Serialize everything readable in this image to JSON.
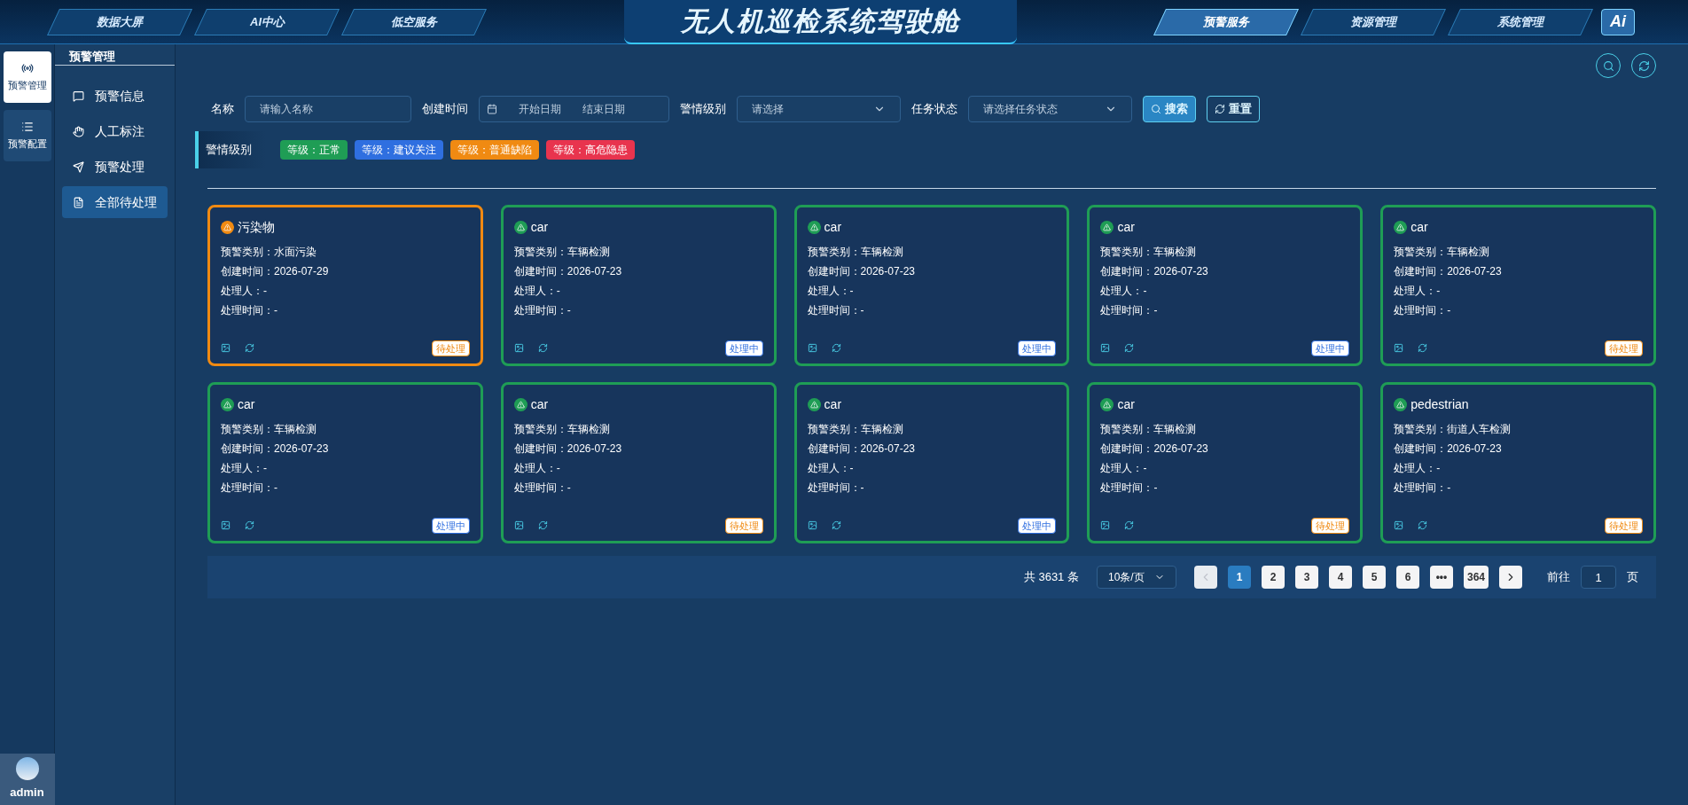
{
  "header": {
    "title": "无人机巡检系统驾驶舱",
    "left_tabs": [
      {
        "label": "数据大屏",
        "selected": false
      },
      {
        "label": "AI中心",
        "selected": false
      },
      {
        "label": "低空服务",
        "selected": false
      }
    ],
    "right_tabs": [
      {
        "label": "预警服务",
        "selected": true
      },
      {
        "label": "资源管理",
        "selected": false
      },
      {
        "label": "系统管理",
        "selected": false
      }
    ],
    "logo": "Ai"
  },
  "rail": {
    "items": [
      {
        "label": "预警管理",
        "selected": true,
        "kind": "signal"
      },
      {
        "label": "预警配置",
        "selected": false,
        "kind": "list"
      }
    ],
    "user": "admin"
  },
  "submenu": {
    "title": "预警管理",
    "items": [
      {
        "label": "预警信息",
        "selected": false,
        "kind": "message"
      },
      {
        "label": "人工标注",
        "selected": false,
        "kind": "hand"
      },
      {
        "label": "预警处理",
        "selected": false,
        "kind": "send"
      },
      {
        "label": "全部待处理",
        "selected": true,
        "kind": "doc"
      }
    ]
  },
  "filters": {
    "name": {
      "label": "名称",
      "placeholder": "请输入名称"
    },
    "date": {
      "label": "创建时间",
      "start_placeholder": "开始日期",
      "end_placeholder": "结束日期"
    },
    "level": {
      "label": "警情级别",
      "placeholder": "请选择"
    },
    "status": {
      "label": "任务状态",
      "placeholder": "请选择任务状态"
    },
    "search_button": "搜索",
    "reset_button": "重置"
  },
  "legend": {
    "title": "警情级别",
    "tags": [
      {
        "label": "等级：正常",
        "color": "#1f9d55"
      },
      {
        "label": "等级：建议关注",
        "color": "#2f6fe0"
      },
      {
        "label": "等级：普通缺陷",
        "color": "#f08a12"
      },
      {
        "label": "等级：高危隐患",
        "color": "#e8344e"
      }
    ]
  },
  "cards": [
    {
      "title": "污染物",
      "color": "#f08a12",
      "fields": [
        "预警类别：水面污染",
        "创建时间：2026-07-29",
        "处理人：-",
        "处理时间：-"
      ],
      "status": {
        "label": "待处理",
        "kind": "pending"
      }
    },
    {
      "title": "car",
      "color": "#1f9d55",
      "fields": [
        "预警类别：车辆检测",
        "创建时间：2026-07-23",
        "处理人：-",
        "处理时间：-"
      ],
      "status": {
        "label": "处理中",
        "kind": "processing"
      }
    },
    {
      "title": "car",
      "color": "#1f9d55",
      "fields": [
        "预警类别：车辆检测",
        "创建时间：2026-07-23",
        "处理人：-",
        "处理时间：-"
      ],
      "status": {
        "label": "处理中",
        "kind": "processing"
      }
    },
    {
      "title": "car",
      "color": "#1f9d55",
      "fields": [
        "预警类别：车辆检测",
        "创建时间：2026-07-23",
        "处理人：-",
        "处理时间：-"
      ],
      "status": {
        "label": "处理中",
        "kind": "processing"
      }
    },
    {
      "title": "car",
      "color": "#1f9d55",
      "fields": [
        "预警类别：车辆检测",
        "创建时间：2026-07-23",
        "处理人：-",
        "处理时间：-"
      ],
      "status": {
        "label": "待处理",
        "kind": "pending"
      }
    },
    {
      "title": "car",
      "color": "#1f9d55",
      "fields": [
        "预警类别：车辆检测",
        "创建时间：2026-07-23",
        "处理人：-",
        "处理时间：-"
      ],
      "status": {
        "label": "处理中",
        "kind": "processing"
      }
    },
    {
      "title": "car",
      "color": "#1f9d55",
      "fields": [
        "预警类别：车辆检测",
        "创建时间：2026-07-23",
        "处理人：-",
        "处理时间：-"
      ],
      "status": {
        "label": "待处理",
        "kind": "pending"
      }
    },
    {
      "title": "car",
      "color": "#1f9d55",
      "fields": [
        "预警类别：车辆检测",
        "创建时间：2026-07-23",
        "处理人：-",
        "处理时间：-"
      ],
      "status": {
        "label": "处理中",
        "kind": "processing"
      }
    },
    {
      "title": "car",
      "color": "#1f9d55",
      "fields": [
        "预警类别：车辆检测",
        "创建时间：2026-07-23",
        "处理人：-",
        "处理时间：-"
      ],
      "status": {
        "label": "待处理",
        "kind": "pending"
      }
    },
    {
      "title": "pedestrian",
      "color": "#1f9d55",
      "fields": [
        "预警类别：街道人车检测",
        "创建时间：2026-07-23",
        "处理人：-",
        "处理时间：-"
      ],
      "status": {
        "label": "待处理",
        "kind": "pending"
      }
    }
  ],
  "pagination": {
    "total": "共 3631 条",
    "page_size": "10条/页",
    "pages": [
      {
        "label": "1",
        "selected": true
      },
      {
        "label": "2",
        "selected": false
      },
      {
        "label": "3",
        "selected": false
      },
      {
        "label": "4",
        "selected": false
      },
      {
        "label": "5",
        "selected": false
      },
      {
        "label": "6",
        "selected": false
      },
      {
        "label": "•••",
        "selected": false
      },
      {
        "label": "364",
        "selected": false
      }
    ],
    "prev_disabled": true,
    "goto_label": "前往",
    "goto_value": "1",
    "goto_suffix": "页"
  }
}
